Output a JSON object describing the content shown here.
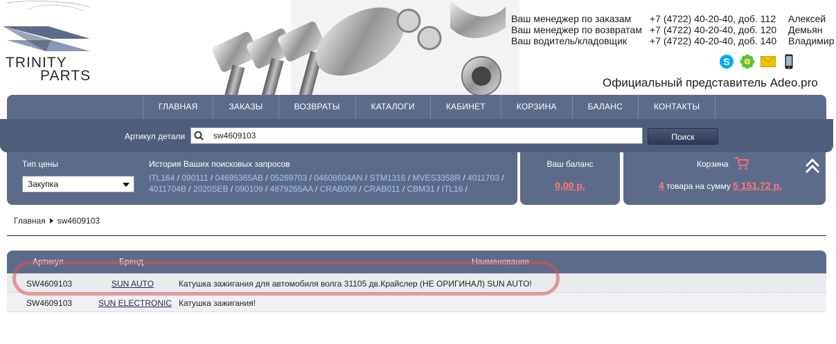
{
  "logo": {
    "line1": "TRINITY",
    "line2": "PARTS"
  },
  "contacts": [
    {
      "role": "Ваш менеджер по заказам",
      "phone": "+7 (4722) 40-20-40, доб. 112",
      "name": "Алексей"
    },
    {
      "role": "Ваш менеджер по возвратам",
      "phone": "+7 (4722) 40-20-40, доб. 120",
      "name": "Демьян"
    },
    {
      "role": "Ваш водитель/кладовщик",
      "phone": "+7 (4722) 40-20-40, доб. 140",
      "name": "Владимир"
    }
  ],
  "social_icons": [
    "skype-icon",
    "icq-icon",
    "mail-icon",
    "phone-icon"
  ],
  "official": "Официальный представитель Adeo.pro",
  "nav": [
    "ГЛАВНАЯ",
    "ЗАКАЗЫ",
    "ВОЗВРАТЫ",
    "КАТАЛОГИ",
    "КАБИНЕТ",
    "КОРЗИНА",
    "БАЛАНС",
    "КОНТАКТЫ"
  ],
  "search": {
    "label": "Артикул детали",
    "value": "sw4609103",
    "button": "Поиск"
  },
  "price_type": {
    "label": "Тип цены",
    "selected": "Закупка"
  },
  "history": {
    "title": "История Ваших поисковых запросов",
    "items": [
      "ITL164",
      "090111",
      "04695365AB",
      "05269703",
      "04608604AN",
      "STM1316",
      "MVES3358R",
      "4011703",
      "4011704B",
      "2020SEB",
      "090109",
      "4879265AA",
      "CRAB009",
      "CRAB011",
      "CBM31",
      "ITL16"
    ]
  },
  "balance": {
    "label": "Ваш баланс",
    "value": "0,00 р."
  },
  "cart": {
    "label": "Корзина",
    "count": "4",
    "mid": " товара на сумму ",
    "sum": "5 151,72 р."
  },
  "breadcrumb": {
    "home": "Главная",
    "current": "sw4609103"
  },
  "table": {
    "headers": {
      "article": "Артикул",
      "brand": "Бренд",
      "name": "Наименование"
    },
    "rows": [
      {
        "article": "SW4609103",
        "brand": "SUN AUTO",
        "name": "Катушка зажигания для автомобиля волга 31105 дв.Крайслер (НЕ ОРИГИНАЛ) SUN AUTO!"
      },
      {
        "article": "SW4609103",
        "brand": "SUN ELECTRONIC",
        "name": "Катушка зажигания!"
      }
    ]
  },
  "colors": {
    "nav": "#5d6b8a",
    "search_bar": "#4f5d7c",
    "link": "#a6c4ea",
    "accent_red": "#ff7a7a"
  }
}
